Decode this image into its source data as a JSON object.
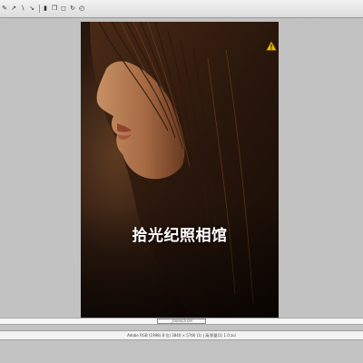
{
  "toolbar": {
    "tools": [
      {
        "name": "pencil-icon",
        "glyph": "✎"
      },
      {
        "name": "brush-icon",
        "glyph": "↗"
      },
      {
        "name": "line-icon",
        "glyph": "∖"
      },
      {
        "name": "transform-icon",
        "glyph": "↘"
      },
      {
        "name": "bucket-icon",
        "glyph": "▮"
      },
      {
        "name": "copy-icon",
        "glyph": "❐"
      },
      {
        "name": "crop-icon",
        "glyph": "◻"
      },
      {
        "name": "rotate-icon",
        "glyph": "↻"
      },
      {
        "name": "reset-icon",
        "glyph": "◴"
      }
    ]
  },
  "photo": {
    "overlay_text": "拾光纪照相馆",
    "warning_color": "#f2b800"
  },
  "filename": "_monica.cel",
  "status": "Adobe RGB (1998) 8 位) 3840 × 5760 (1) | 高/质量(1) 1.0 zoi"
}
